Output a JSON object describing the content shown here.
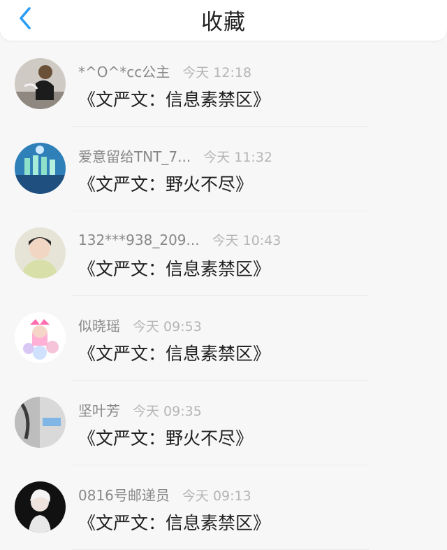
{
  "header": {
    "title": "收藏",
    "back_icon": "chevron-left-icon",
    "back_color": "#2a9df4"
  },
  "favorites": [
    {
      "username": "*^O^*cc公主",
      "time": "今天 12:18",
      "content": "《文严文：信息素禁区》"
    },
    {
      "username": "爱意留给TNT_7...",
      "time": "今天 11:32",
      "content": "《文严文：野火不尽》"
    },
    {
      "username": "132***938_209...",
      "time": "今天 10:43",
      "content": "《文严文：信息素禁区》"
    },
    {
      "username": "似晓瑶",
      "time": "今天 09:53",
      "content": "《文严文：信息素禁区》"
    },
    {
      "username": "坚叶芳",
      "time": "今天 09:35",
      "content": "《文严文：野火不尽》"
    },
    {
      "username": "0816号邮递员",
      "time": "今天 09:13",
      "content": "《文严文：信息素禁区》"
    }
  ]
}
